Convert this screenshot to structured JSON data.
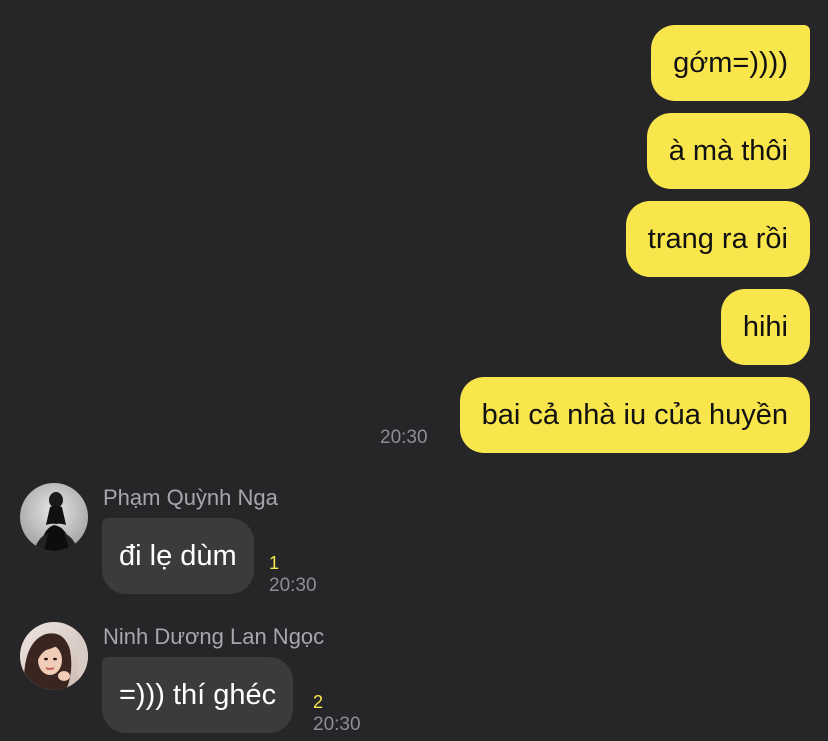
{
  "outgoing": [
    {
      "text": "gớm=))))"
    },
    {
      "text": "à mà thôi"
    },
    {
      "text": "trang ra rồi"
    },
    {
      "text": "hihi"
    },
    {
      "text": "bai cả nhà iu của huyền",
      "time": "20:30"
    }
  ],
  "incoming": [
    {
      "sender": "Phạm Quỳnh Nga",
      "text": "đi lẹ dùm",
      "unread": "1",
      "time": "20:30"
    },
    {
      "sender": "Ninh Dương Lan Ngọc",
      "text": "=))) thí ghéc",
      "unread": "2",
      "time": "20:30"
    }
  ],
  "colors": {
    "background": "#262628",
    "outgoing_bubble": "#F9E54C",
    "incoming_bubble": "#3b3b3e",
    "unread_count": "#F9E54C",
    "timestamp": "#8e8e93"
  }
}
